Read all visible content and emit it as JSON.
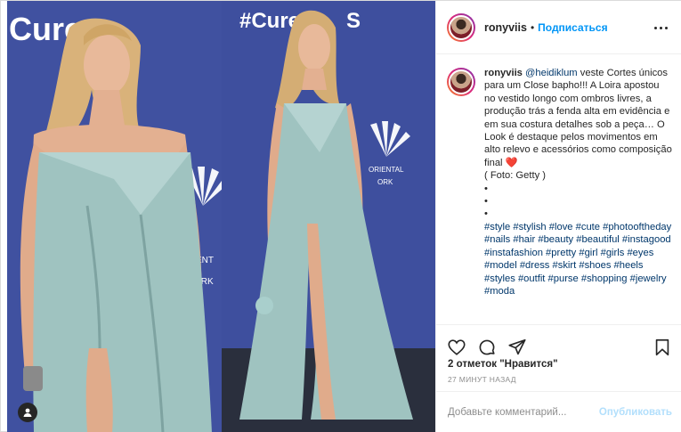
{
  "post": {
    "username": "ronyviis",
    "follow_label": "Подписаться",
    "more_icon": "more-horizontal-icon",
    "caption": {
      "user": "ronyviis",
      "mention": "@heidiklum",
      "text": " veste Cortes únicos para um Close bapho!!! A Loira apostou no vestido longo com ombros livres, a produção trás a fenda alta em evidência e em sua costura detalhes sob a peça… O Look é destaque pelos movimentos em alto relevo e acessórios como composição final",
      "emoji": "❤️",
      "credit": "( Foto: Getty )",
      "dots": [
        "•",
        "•",
        "•"
      ],
      "hashtags": [
        "#style",
        "#stylish",
        "#love",
        "#cute",
        "#photooftheday",
        "#nails",
        "#hair",
        "#beauty",
        "#beautiful",
        "#instagood",
        "#instafashion",
        "#pretty",
        "#girl",
        "#girls",
        "#eyes",
        "#model",
        "#dress",
        "#skirt",
        "#shoes",
        "#heels",
        "#styles",
        "#outfit",
        "#purse",
        "#shopping",
        "#jewelry",
        "#moda"
      ]
    },
    "likes_count": "2 отметок",
    "likes_label": "\"Нравится\"",
    "timestamp": "27 МИНУТ НАЗАД",
    "comment_placeholder": "Добавьте комментарий...",
    "publish_label": "Опубликовать"
  },
  "photo": {
    "backdrop_text_left": "Cure",
    "backdrop_text_right": "#Cure",
    "backdrop_text_right_tail": "S",
    "sponsor_lines": [
      "RIENT",
      "ORK"
    ],
    "sponsor_lines_right": [
      "ORIENTAL",
      "ORK"
    ],
    "backdrop_color": "#3d4e9c",
    "dress_color": "#9fc3c0"
  },
  "icons": {
    "like": "heart-icon",
    "comment": "comment-icon",
    "share": "share-icon",
    "save": "bookmark-icon",
    "user_tag": "user-tag-icon"
  }
}
